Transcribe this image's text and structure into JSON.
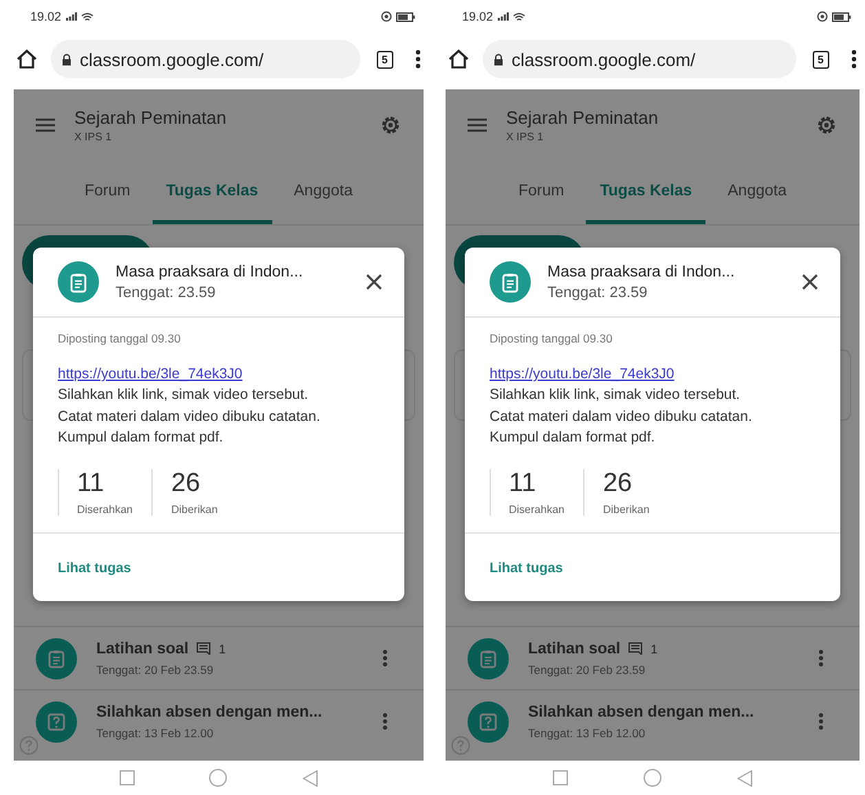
{
  "phones": [
    {
      "status_bar": {
        "time": "19.02"
      },
      "browser": {
        "url": "classroom.google.com/",
        "tab_count": "5"
      },
      "course": {
        "title": "Sejarah Peminatan",
        "subtitle": "X IPS 1"
      },
      "tabs": [
        {
          "label": "Forum",
          "selected": false
        },
        {
          "label": "Tugas Kelas",
          "selected": true
        },
        {
          "label": "Anggota",
          "selected": false
        }
      ],
      "dialog": {
        "title": "Masa praaksara di Indon...",
        "due": "Tenggat: 23.59",
        "posted": "Diposting tanggal 09.30",
        "link": "https://youtu.be/3le_74ek3J0",
        "body": "Silahkan klik link, simak video tersebut.\nCatat materi dalam video dibuku catatan.\nKumpul dalam format pdf.",
        "stats": [
          {
            "count": "11",
            "label": "Diserahkan"
          },
          {
            "count": "26",
            "label": "Diberikan"
          }
        ],
        "action": "Lihat tugas"
      },
      "assignments": [
        {
          "kind": "assignment",
          "title": "Latihan soal",
          "comments": "1",
          "due": "Tenggat: 20 Feb 23.59"
        },
        {
          "kind": "question",
          "title": "Silahkan absen dengan men...",
          "due": "Tenggat: 13 Feb 12.00"
        }
      ]
    },
    {
      "status_bar": {
        "time": "19.02"
      },
      "browser": {
        "url": "classroom.google.com/",
        "tab_count": "5"
      },
      "course": {
        "title": "Sejarah Peminatan",
        "subtitle": "X IPS 1"
      },
      "tabs": [
        {
          "label": "Forum",
          "selected": false
        },
        {
          "label": "Tugas Kelas",
          "selected": true
        },
        {
          "label": "Anggota",
          "selected": false
        }
      ],
      "dialog": {
        "title": "Masa praaksara di Indon...",
        "due": "Tenggat: 23.59",
        "posted": "Diposting tanggal 09.30",
        "link": "https://youtu.be/3le_74ek3J0",
        "body": "Silahkan klik link, simak video tersebut.\nCatat materi dalam video dibuku catatan.\nKumpul dalam format pdf.",
        "stats": [
          {
            "count": "11",
            "label": "Diserahkan"
          },
          {
            "count": "26",
            "label": "Diberikan"
          }
        ],
        "action": "Lihat tugas"
      },
      "assignments": [
        {
          "kind": "assignment",
          "title": "Latihan soal",
          "comments": "1",
          "due": "Tenggat: 20 Feb 23.59"
        },
        {
          "kind": "question",
          "title": "Silahkan absen dengan men...",
          "due": "Tenggat: 13 Feb 12.00"
        }
      ]
    }
  ]
}
